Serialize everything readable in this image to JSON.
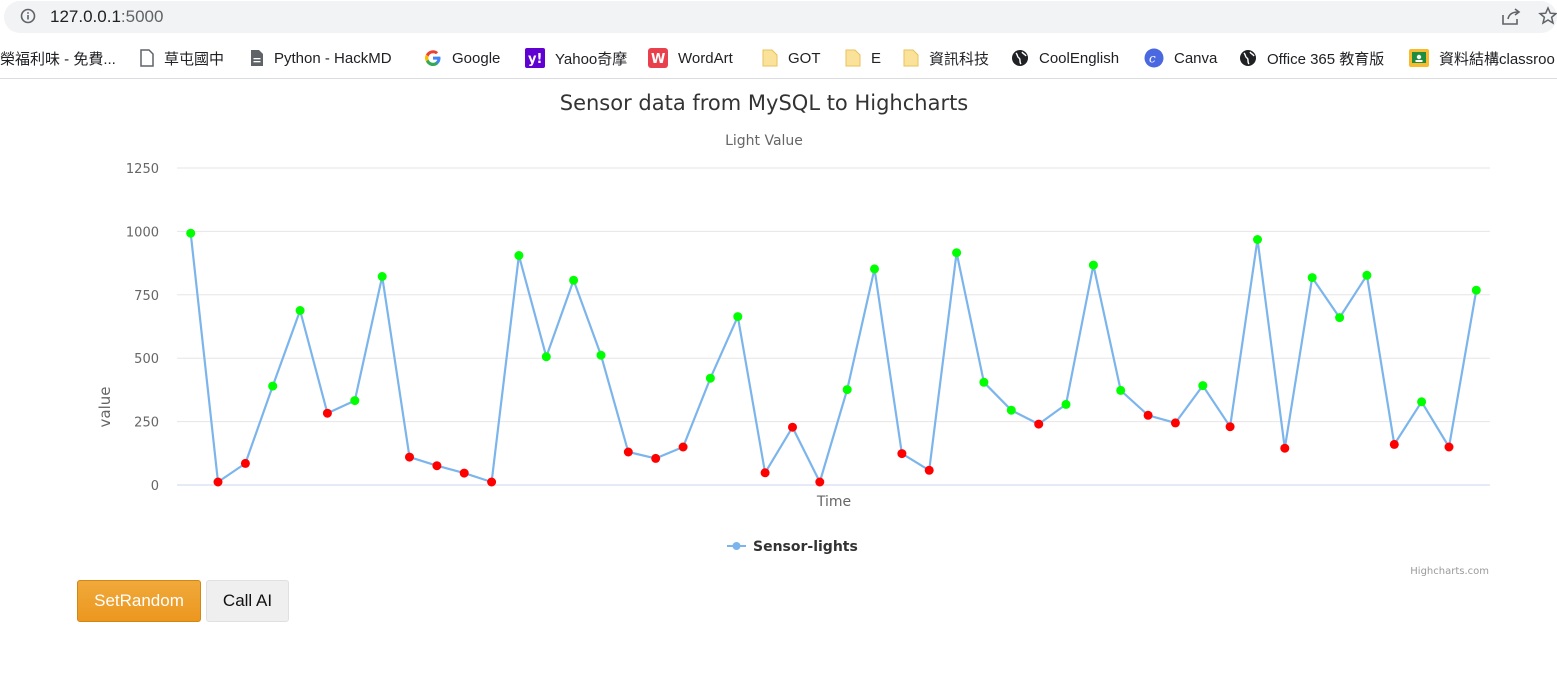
{
  "browser": {
    "url_host": "127.0.0.1",
    "url_port": ":5000",
    "bookmarks": [
      {
        "label": "榮福利味 - 免費...",
        "icon": "none"
      },
      {
        "label": "草屯國中",
        "icon": "page-icon"
      },
      {
        "label": "Python - HackMD",
        "icon": "document-icon"
      },
      {
        "label": "Google",
        "icon": "google-icon"
      },
      {
        "label": "Yahoo奇摩",
        "icon": "yahoo-icon"
      },
      {
        "label": "WordArt",
        "icon": "wordart-icon"
      },
      {
        "label": "GOT",
        "icon": "folder-icon"
      },
      {
        "label": "E",
        "icon": "folder-icon"
      },
      {
        "label": "資訊科技",
        "icon": "folder-icon"
      },
      {
        "label": "CoolEnglish",
        "icon": "globe-icon"
      },
      {
        "label": "Canva",
        "icon": "canva-icon"
      },
      {
        "label": "Office 365 教育版",
        "icon": "globe-icon"
      },
      {
        "label": "資料結構classroo",
        "icon": "classroom-icon"
      }
    ]
  },
  "chart_data": {
    "type": "line",
    "title": "Sensor data from MySQL to Highcharts",
    "subtitle": "Light Value",
    "xlabel": "Time",
    "ylabel": "value",
    "ylim": [
      0,
      1250
    ],
    "yticks": [
      0,
      250,
      500,
      750,
      1000,
      1250
    ],
    "grid": true,
    "legend_position": "bottom-center",
    "credits": "Highcharts.com",
    "line_color": "#7cb5ec",
    "point_colors": {
      "above_threshold": "#00ff00",
      "below_threshold": "#ff0000"
    },
    "series": [
      {
        "name": "Sensor-lights",
        "values": [
          993,
          12,
          85,
          390,
          688,
          283,
          333,
          822,
          110,
          76,
          47,
          12,
          905,
          506,
          807,
          512,
          130,
          105,
          150,
          421,
          664,
          48,
          228,
          12,
          376,
          852,
          124,
          58,
          916,
          405,
          295,
          240,
          318,
          867,
          373,
          275,
          245,
          392,
          230,
          968,
          145,
          818,
          660,
          827,
          160,
          328,
          150,
          768
        ],
        "point_color_flags": [
          "green",
          "red",
          "red",
          "green",
          "green",
          "red",
          "green",
          "green",
          "red",
          "red",
          "red",
          "red",
          "green",
          "green",
          "green",
          "green",
          "red",
          "red",
          "red",
          "green",
          "green",
          "red",
          "red",
          "red",
          "green",
          "green",
          "red",
          "red",
          "green",
          "green",
          "green",
          "red",
          "green",
          "green",
          "green",
          "red",
          "red",
          "green",
          "red",
          "green",
          "red",
          "green",
          "green",
          "green",
          "red",
          "green",
          "red",
          "green"
        ]
      }
    ]
  },
  "controls": {
    "set_random_label": "SetRandom",
    "call_ai_label": "Call AI"
  }
}
